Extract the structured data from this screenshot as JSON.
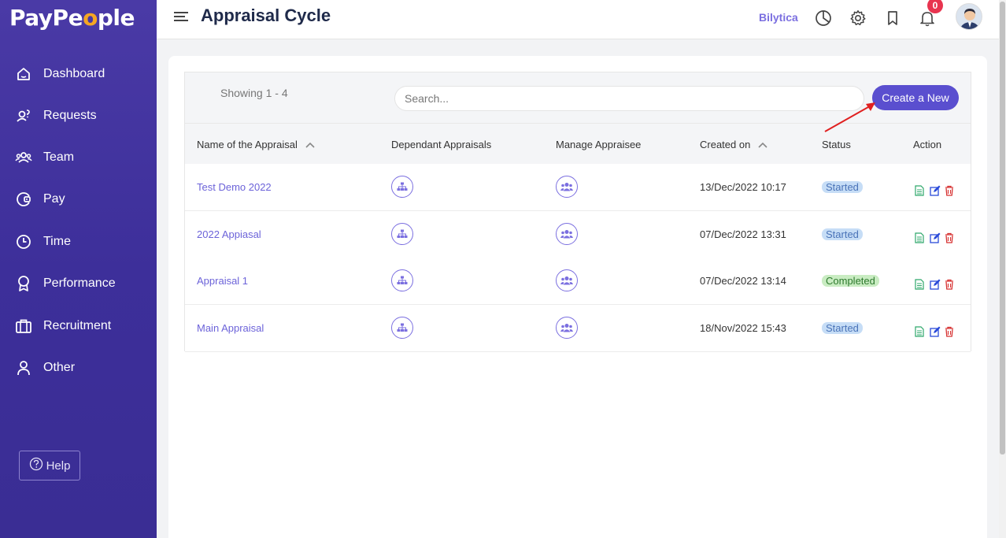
{
  "sidebar": {
    "logo_prefix": "PayPe",
    "logo_o": "o",
    "logo_suffix": "ple",
    "items": [
      {
        "label": "Dashboard",
        "icon": "home-icon"
      },
      {
        "label": "Requests",
        "icon": "user-question-icon"
      },
      {
        "label": "Team",
        "icon": "team-icon"
      },
      {
        "label": "Pay",
        "icon": "wallet-icon"
      },
      {
        "label": "Time",
        "icon": "clock-icon"
      },
      {
        "label": "Performance",
        "icon": "award-icon"
      },
      {
        "label": "Recruitment",
        "icon": "briefcase-icon"
      },
      {
        "label": "Other",
        "icon": "user-icon"
      }
    ],
    "help_label": "Help"
  },
  "header": {
    "title": "Appraisal Cycle",
    "brand_link": "Bilytica",
    "notification_count": "0"
  },
  "toolbar": {
    "showing": "Showing 1 - 4",
    "search_placeholder": "Search...",
    "create_label": "Create a New"
  },
  "table": {
    "columns": [
      "Name of the Appraisal",
      "Dependant Appraisals",
      "Manage Appraisee",
      "Created on",
      "Status",
      "Action"
    ],
    "rows": [
      {
        "name": "Test Demo 2022",
        "created": "13/Dec/2022 10:17",
        "status": "Started"
      },
      {
        "name": "2022 Appiasal",
        "created": "07/Dec/2022 13:31",
        "status": "Started"
      },
      {
        "name": "Appraisal 1",
        "created": "07/Dec/2022 13:14",
        "status": "Completed"
      },
      {
        "name": "Main Appraisal",
        "created": "18/Nov/2022 15:43",
        "status": "Started"
      }
    ]
  },
  "colors": {
    "sidebar": "#4a3aa6",
    "accent": "#5a4fcf",
    "link": "#6c63d9",
    "started_bg": "#c6ddf6",
    "completed_bg": "#c9ecc2",
    "badge": "#e8344f"
  }
}
